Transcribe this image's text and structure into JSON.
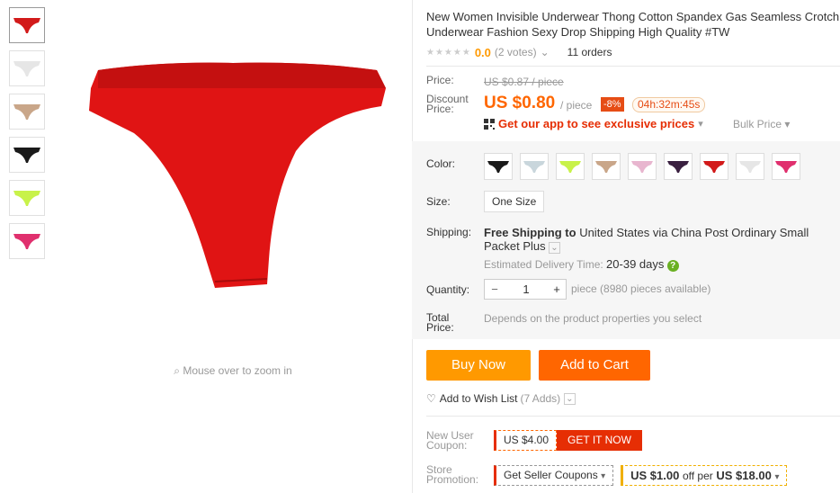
{
  "title": "New Women Invisible Underwear Thong Cotton Spandex Gas Seamless Crotch Underwear Fashion Sexy Drop Shipping High Quality #TW",
  "title_line1": "New Women Invisible Underwear Thong Cotton Spandex Gas Seamless Crotch",
  "title_line2": "Underwear Fashion Sexy Drop Shipping High Quality #TW",
  "rating": {
    "stars": "★★★★★",
    "value": "0.0",
    "votes": "(2 votes)",
    "votes_caret": "⌄",
    "orders": "11 orders"
  },
  "price": {
    "label": "Price:",
    "old": "US $0.87 / piece",
    "discount_label_1": "Discount",
    "discount_label_2": "Price:",
    "current": "US $0.80",
    "per": "/ piece",
    "discount": "-8%",
    "timer": "04h:32m:45s",
    "app_promo": "Get our app to see exclusive prices",
    "app_caret": "▾",
    "bulk": "Bulk Price ▾"
  },
  "options": {
    "color_label": "Color:",
    "colors": [
      "#1a1a1a",
      "#c9d6dc",
      "#c8f24a",
      "#c9a689",
      "#e8b6cf",
      "#3a2040",
      "#d21a1a",
      "#e6e6e6",
      "#e0306e"
    ],
    "size_label": "Size:",
    "size_value": "One Size"
  },
  "shipping": {
    "label": "Shipping:",
    "free": "Free Shipping to",
    "dest": "United States via China Post Ordinary Small Packet Plus",
    "caret": "⌄",
    "est_label": "Estimated Delivery Time:",
    "est_value": "20-39 days"
  },
  "quantity": {
    "label": "Quantity:",
    "minus": "−",
    "value": "1",
    "plus": "+",
    "available": "piece (8980 pieces available)"
  },
  "total": {
    "label_1": "Total",
    "label_2": "Price:",
    "value": "Depends on the product properties you select"
  },
  "buttons": {
    "buy": "Buy Now",
    "cart": "Add to Cart"
  },
  "wishlist": {
    "label": "Add to Wish List",
    "count": "(7 Adds)",
    "caret": "⌄"
  },
  "coupons": {
    "new_user_1": "New User",
    "new_user_2": "Coupon:",
    "new_user_value": "US $4.00",
    "get_it": "GET IT NOW",
    "store_1": "Store",
    "store_2": "Promotion:",
    "seller": "Get Seller Coupons",
    "seller_caret": "▾",
    "offer_amt": "US $1.00",
    "offer_mid": "off per",
    "offer_min": "US $18.00",
    "offer_caret": "▾"
  },
  "zoom_hint": "Mouse over to zoom in",
  "thumb_colors": [
    "#d21a1a",
    "#e6e6e6",
    "#c9a689",
    "#1a1a1a",
    "#c8f24a",
    "#e0306e"
  ],
  "main_color": "#e01414"
}
